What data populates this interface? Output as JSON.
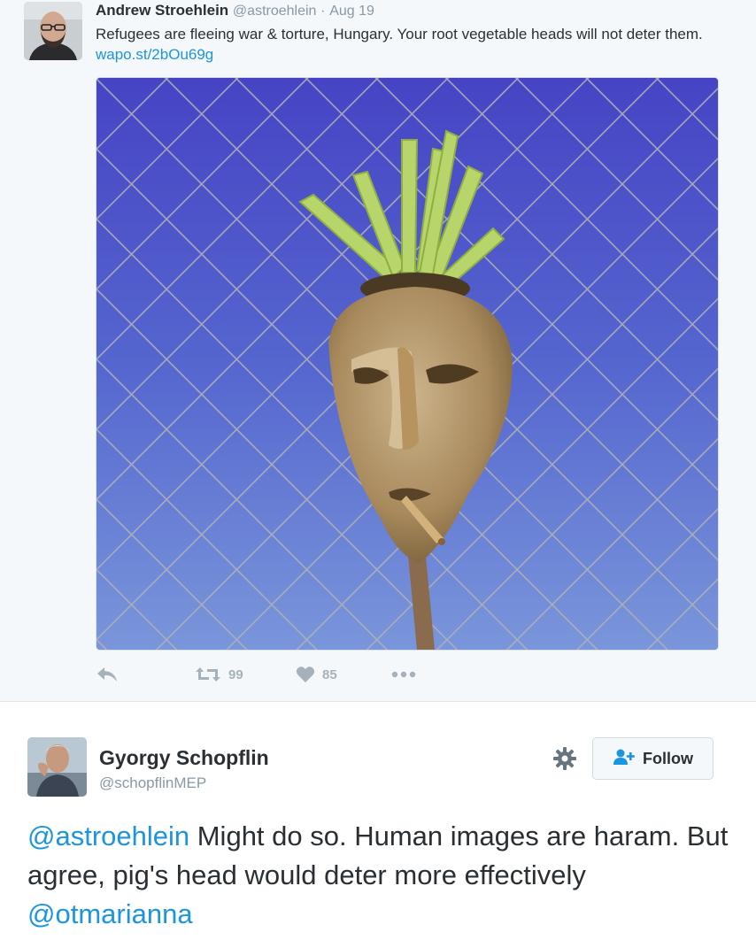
{
  "original_tweet": {
    "author_name": "Andrew Stroehlein",
    "author_handle": "@astroehlein",
    "separator": "·",
    "date": "Aug 19",
    "text_before_link": "Refugees are fleeing war & torture, Hungary. Your root vegetable heads will not deter them. ",
    "link_text": "wapo.st/2bOu69g",
    "actions": {
      "reply_icon": "reply-icon",
      "retweet_icon": "retweet-icon",
      "retweet_count": "99",
      "like_icon": "heart-icon",
      "like_count": "85",
      "more_icon": "more-dots-icon"
    }
  },
  "reply_tweet": {
    "author_name": "Gyorgy Schopflin",
    "author_handle": "@schopflinMEP",
    "follow_label": "Follow",
    "mention_1": "@astroehlein",
    "text_middle": " Might do so. Human images are haram. But agree, pig's head would deter more effectively ",
    "mention_2": "@otmarianna"
  },
  "colors": {
    "link_blue": "#1b95e0",
    "text_dark": "#292f33",
    "text_grey": "#8899a6",
    "action_grey": "#a6b2bb"
  }
}
